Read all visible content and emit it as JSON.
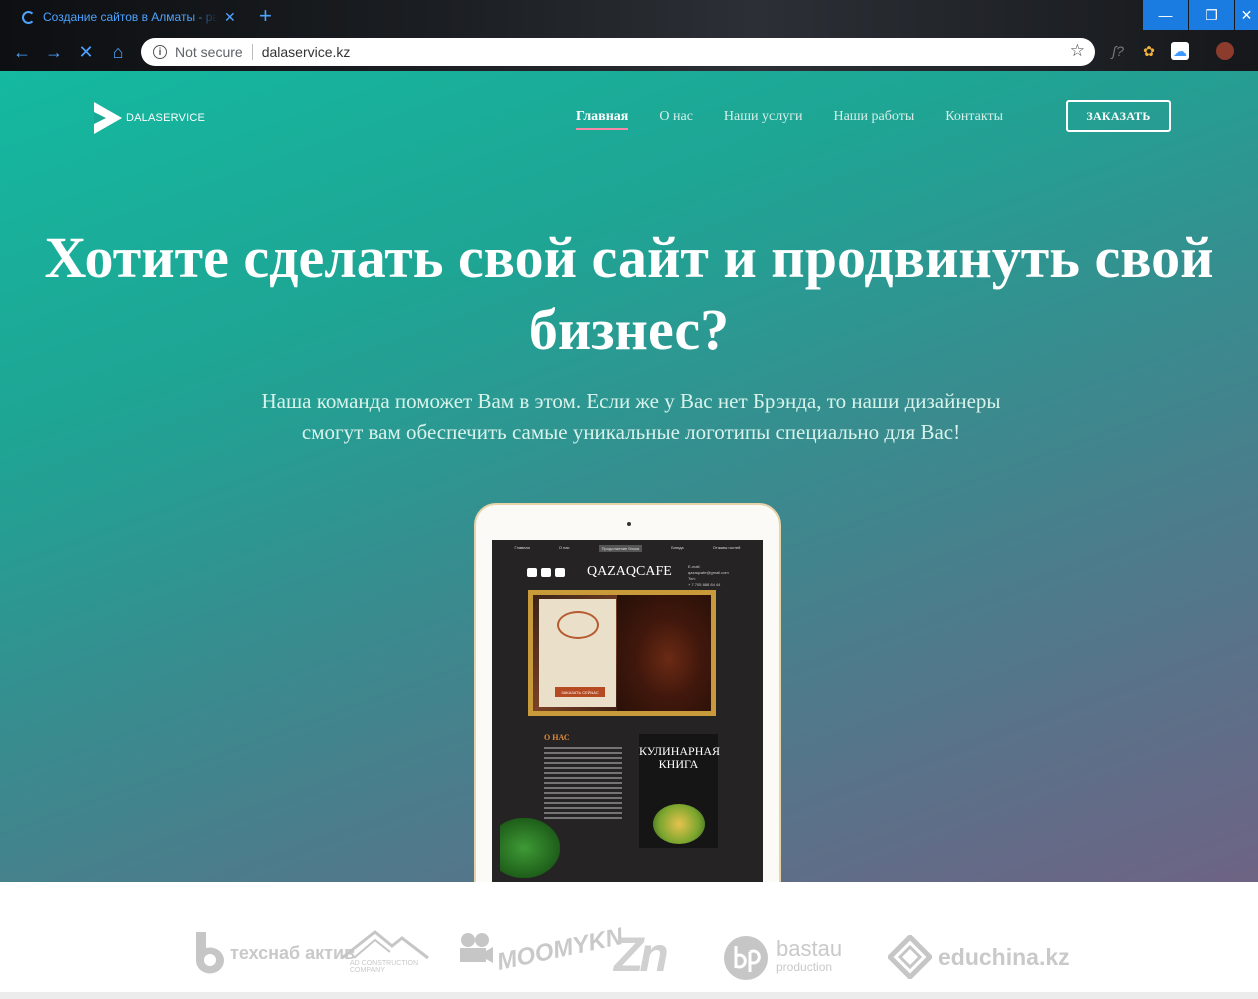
{
  "browser": {
    "tab_title": "Создание сайтов в Алматы - ра",
    "tab_close": "✕",
    "new_tab": "+",
    "window_buttons": {
      "minimize": "—",
      "maximize": "❐",
      "close": "✕"
    },
    "back": "←",
    "forward": "→",
    "stop": "✕",
    "home": "⌂",
    "security_label": "Not secure",
    "url": "dalaservice.kz",
    "bookmark": "☆",
    "extensions": [
      "ʃ?",
      "✿",
      "☁"
    ]
  },
  "site": {
    "logo_text": "DALASERVICE",
    "nav": [
      {
        "label": "Главная",
        "active": true
      },
      {
        "label": "О нас"
      },
      {
        "label": "Наши услуги"
      },
      {
        "label": "Наши работы"
      },
      {
        "label": "Контакты"
      }
    ],
    "order_button": "ЗАКАЗАТЬ",
    "headline_line1": "Хотите сделать свой сайт и продвинуть свой",
    "headline_line2": "бизнес?",
    "subtitle_line1": "Наша команда поможет Вам в этом. Если же у Вас нет Брэнда, то наши дизайнеры",
    "subtitle_line2": "смогут вам обеспечить самые уникальные логотипы специально для Вас!",
    "colors": {
      "gradient_start": "#14b9a0",
      "gradient_end": "#6e6384",
      "active_underline": "#f48aa8"
    }
  },
  "mockup": {
    "nav": [
      "Главная",
      "О нас",
      "Продолжение блока",
      "Блюда",
      "Отзывы гостей"
    ],
    "brand": "QAZAQCAFE",
    "contact_email_label": "E-mail:",
    "contact_email": "qazaqcafe@gmail.com",
    "contact_phone_label": "Тел:",
    "contact_phone": "+ 7 705 888 84 44",
    "cta": "ЗАКАЗАТЬ СЕЙЧАС",
    "about_title": "О НАС",
    "book_title_line1": "КУЛИНАРНАЯ",
    "book_title_line2": "КНИГА"
  },
  "partners": [
    {
      "name": "техснаб актив",
      "icon": "b-mark"
    },
    {
      "name": "AD CONSTRUCTION COMPANY",
      "icon": "mountain"
    },
    {
      "name": "MOOMYKN",
      "icon": "camera"
    },
    {
      "name": "Zn",
      "icon": "zn-mark"
    },
    {
      "name_line1": "bastau",
      "name_line2": "production",
      "icon": "bp-circle"
    },
    {
      "name": "educhina.kz",
      "icon": "diamond"
    }
  ]
}
